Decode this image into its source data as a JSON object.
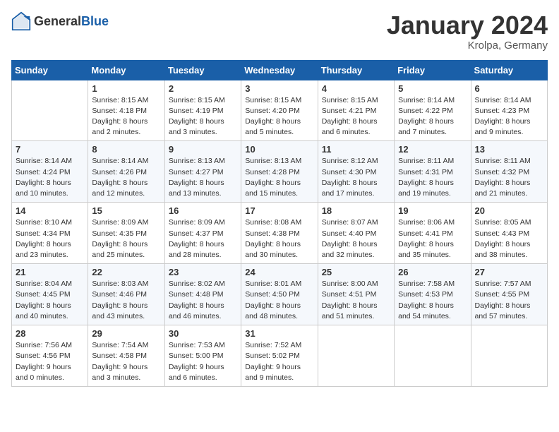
{
  "header": {
    "logo_general": "General",
    "logo_blue": "Blue",
    "month_title": "January 2024",
    "location": "Krolpa, Germany"
  },
  "weekdays": [
    "Sunday",
    "Monday",
    "Tuesday",
    "Wednesday",
    "Thursday",
    "Friday",
    "Saturday"
  ],
  "weeks": [
    [
      {
        "day": "",
        "empty": true
      },
      {
        "day": "1",
        "sunrise": "Sunrise: 8:15 AM",
        "sunset": "Sunset: 4:18 PM",
        "daylight": "Daylight: 8 hours and 2 minutes."
      },
      {
        "day": "2",
        "sunrise": "Sunrise: 8:15 AM",
        "sunset": "Sunset: 4:19 PM",
        "daylight": "Daylight: 8 hours and 3 minutes."
      },
      {
        "day": "3",
        "sunrise": "Sunrise: 8:15 AM",
        "sunset": "Sunset: 4:20 PM",
        "daylight": "Daylight: 8 hours and 5 minutes."
      },
      {
        "day": "4",
        "sunrise": "Sunrise: 8:15 AM",
        "sunset": "Sunset: 4:21 PM",
        "daylight": "Daylight: 8 hours and 6 minutes."
      },
      {
        "day": "5",
        "sunrise": "Sunrise: 8:14 AM",
        "sunset": "Sunset: 4:22 PM",
        "daylight": "Daylight: 8 hours and 7 minutes."
      },
      {
        "day": "6",
        "sunrise": "Sunrise: 8:14 AM",
        "sunset": "Sunset: 4:23 PM",
        "daylight": "Daylight: 8 hours and 9 minutes."
      }
    ],
    [
      {
        "day": "7",
        "sunrise": "Sunrise: 8:14 AM",
        "sunset": "Sunset: 4:24 PM",
        "daylight": "Daylight: 8 hours and 10 minutes."
      },
      {
        "day": "8",
        "sunrise": "Sunrise: 8:14 AM",
        "sunset": "Sunset: 4:26 PM",
        "daylight": "Daylight: 8 hours and 12 minutes."
      },
      {
        "day": "9",
        "sunrise": "Sunrise: 8:13 AM",
        "sunset": "Sunset: 4:27 PM",
        "daylight": "Daylight: 8 hours and 13 minutes."
      },
      {
        "day": "10",
        "sunrise": "Sunrise: 8:13 AM",
        "sunset": "Sunset: 4:28 PM",
        "daylight": "Daylight: 8 hours and 15 minutes."
      },
      {
        "day": "11",
        "sunrise": "Sunrise: 8:12 AM",
        "sunset": "Sunset: 4:30 PM",
        "daylight": "Daylight: 8 hours and 17 minutes."
      },
      {
        "day": "12",
        "sunrise": "Sunrise: 8:11 AM",
        "sunset": "Sunset: 4:31 PM",
        "daylight": "Daylight: 8 hours and 19 minutes."
      },
      {
        "day": "13",
        "sunrise": "Sunrise: 8:11 AM",
        "sunset": "Sunset: 4:32 PM",
        "daylight": "Daylight: 8 hours and 21 minutes."
      }
    ],
    [
      {
        "day": "14",
        "sunrise": "Sunrise: 8:10 AM",
        "sunset": "Sunset: 4:34 PM",
        "daylight": "Daylight: 8 hours and 23 minutes."
      },
      {
        "day": "15",
        "sunrise": "Sunrise: 8:09 AM",
        "sunset": "Sunset: 4:35 PM",
        "daylight": "Daylight: 8 hours and 25 minutes."
      },
      {
        "day": "16",
        "sunrise": "Sunrise: 8:09 AM",
        "sunset": "Sunset: 4:37 PM",
        "daylight": "Daylight: 8 hours and 28 minutes."
      },
      {
        "day": "17",
        "sunrise": "Sunrise: 8:08 AM",
        "sunset": "Sunset: 4:38 PM",
        "daylight": "Daylight: 8 hours and 30 minutes."
      },
      {
        "day": "18",
        "sunrise": "Sunrise: 8:07 AM",
        "sunset": "Sunset: 4:40 PM",
        "daylight": "Daylight: 8 hours and 32 minutes."
      },
      {
        "day": "19",
        "sunrise": "Sunrise: 8:06 AM",
        "sunset": "Sunset: 4:41 PM",
        "daylight": "Daylight: 8 hours and 35 minutes."
      },
      {
        "day": "20",
        "sunrise": "Sunrise: 8:05 AM",
        "sunset": "Sunset: 4:43 PM",
        "daylight": "Daylight: 8 hours and 38 minutes."
      }
    ],
    [
      {
        "day": "21",
        "sunrise": "Sunrise: 8:04 AM",
        "sunset": "Sunset: 4:45 PM",
        "daylight": "Daylight: 8 hours and 40 minutes."
      },
      {
        "day": "22",
        "sunrise": "Sunrise: 8:03 AM",
        "sunset": "Sunset: 4:46 PM",
        "daylight": "Daylight: 8 hours and 43 minutes."
      },
      {
        "day": "23",
        "sunrise": "Sunrise: 8:02 AM",
        "sunset": "Sunset: 4:48 PM",
        "daylight": "Daylight: 8 hours and 46 minutes."
      },
      {
        "day": "24",
        "sunrise": "Sunrise: 8:01 AM",
        "sunset": "Sunset: 4:50 PM",
        "daylight": "Daylight: 8 hours and 48 minutes."
      },
      {
        "day": "25",
        "sunrise": "Sunrise: 8:00 AM",
        "sunset": "Sunset: 4:51 PM",
        "daylight": "Daylight: 8 hours and 51 minutes."
      },
      {
        "day": "26",
        "sunrise": "Sunrise: 7:58 AM",
        "sunset": "Sunset: 4:53 PM",
        "daylight": "Daylight: 8 hours and 54 minutes."
      },
      {
        "day": "27",
        "sunrise": "Sunrise: 7:57 AM",
        "sunset": "Sunset: 4:55 PM",
        "daylight": "Daylight: 8 hours and 57 minutes."
      }
    ],
    [
      {
        "day": "28",
        "sunrise": "Sunrise: 7:56 AM",
        "sunset": "Sunset: 4:56 PM",
        "daylight": "Daylight: 9 hours and 0 minutes."
      },
      {
        "day": "29",
        "sunrise": "Sunrise: 7:54 AM",
        "sunset": "Sunset: 4:58 PM",
        "daylight": "Daylight: 9 hours and 3 minutes."
      },
      {
        "day": "30",
        "sunrise": "Sunrise: 7:53 AM",
        "sunset": "Sunset: 5:00 PM",
        "daylight": "Daylight: 9 hours and 6 minutes."
      },
      {
        "day": "31",
        "sunrise": "Sunrise: 7:52 AM",
        "sunset": "Sunset: 5:02 PM",
        "daylight": "Daylight: 9 hours and 9 minutes."
      },
      {
        "day": "",
        "empty": true
      },
      {
        "day": "",
        "empty": true
      },
      {
        "day": "",
        "empty": true
      }
    ]
  ]
}
